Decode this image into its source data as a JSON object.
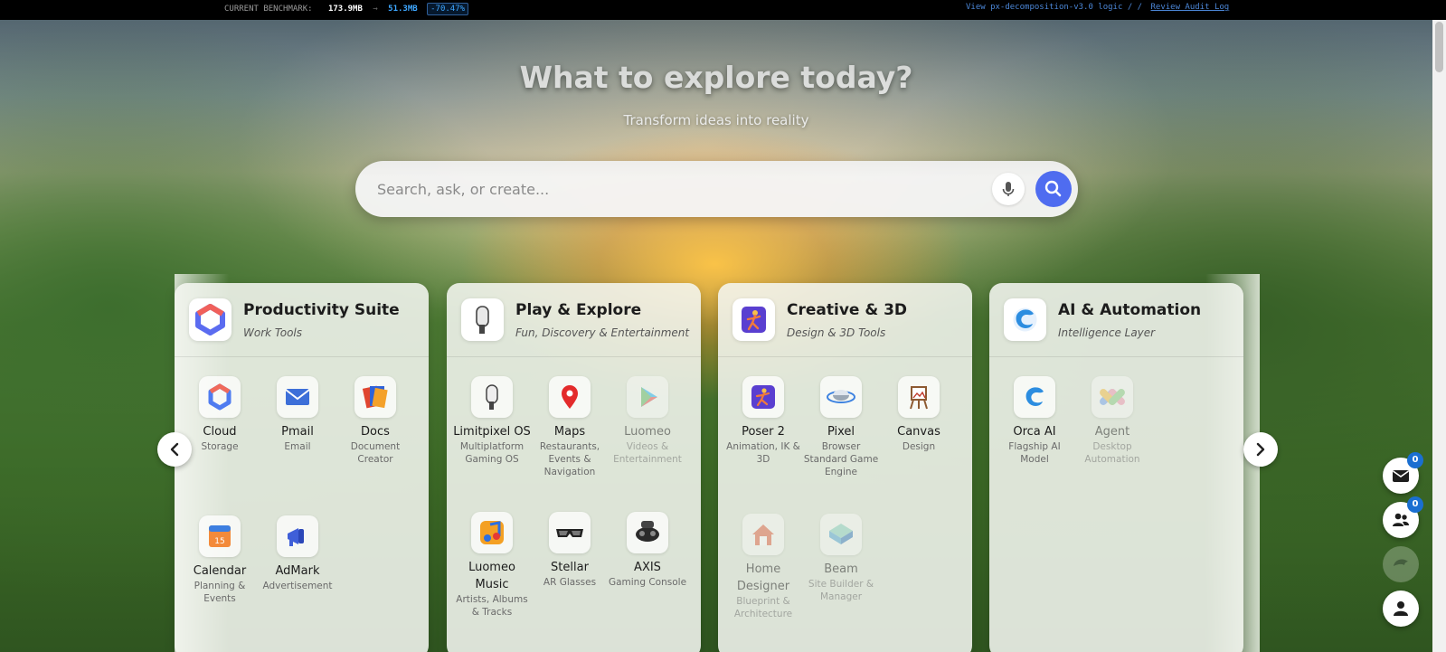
{
  "benchmark": {
    "label": "CURRENT BENCHMARK:",
    "value1": "173.9MB",
    "separator": "→",
    "value2": "51.3MB",
    "percent": "-70.47%"
  },
  "top_links": {
    "logic_link": "View px-decomposition-v3.0 logic",
    "separator": "/ /",
    "audit_link": "Review Audit Log"
  },
  "hero": {
    "title": "What to explore today?",
    "subtitle": "Transform ideas into reality"
  },
  "search": {
    "placeholder": "Search, ask, or create..."
  },
  "cards": [
    {
      "title": "Productivity Suite",
      "subtitle": "Work Tools",
      "icon": "suite-logo-icon",
      "apps": [
        {
          "name": "Cloud",
          "desc": "Storage",
          "icon": "cloud-storage-icon"
        },
        {
          "name": "Pmail",
          "desc": "Email",
          "icon": "mail-icon"
        },
        {
          "name": "Docs",
          "desc": "Document Creator",
          "icon": "docs-icon"
        },
        {
          "name": "Calendar",
          "desc": "Planning & Events",
          "icon": "calendar-icon"
        },
        {
          "name": "AdMark",
          "desc": "Advertisement",
          "icon": "megaphone-icon"
        }
      ]
    },
    {
      "title": "Play & Explore",
      "subtitle": "Fun, Discovery & Entertainment",
      "icon": "controller-icon",
      "apps": [
        {
          "name": "Limitpixel OS",
          "desc": "Multiplatform Gaming OS",
          "icon": "controller-icon"
        },
        {
          "name": "Maps",
          "desc": "Restaurants, Events & Navigation",
          "icon": "map-pin-icon"
        },
        {
          "name": "Luomeo",
          "desc": "Videos & Entertainment",
          "icon": "play-icon"
        },
        {
          "name": "Luomeo Music",
          "desc": "Artists, Albums & Tracks",
          "icon": "music-note-icon"
        },
        {
          "name": "Stellar",
          "desc": "AR Glasses",
          "icon": "ar-glasses-icon"
        },
        {
          "name": "AXIS",
          "desc": "Gaming Console",
          "icon": "gaming-console-icon"
        }
      ]
    },
    {
      "title": "Creative & 3D",
      "subtitle": "Design & 3D Tools",
      "icon": "poser-figure-icon",
      "apps": [
        {
          "name": "Poser 2",
          "desc": "Animation, IK & 3D",
          "icon": "poser-figure-icon"
        },
        {
          "name": "Pixel",
          "desc": "Browser Standard Game Engine",
          "icon": "orbit-engine-icon"
        },
        {
          "name": "Canvas",
          "desc": "Design",
          "icon": "easel-icon"
        },
        {
          "name": "Home Designer",
          "desc": "Blueprint & Architecture",
          "icon": "house-icon"
        },
        {
          "name": "Beam",
          "desc": "Site Builder & Manager",
          "icon": "layers-icon"
        }
      ]
    },
    {
      "title": "AI & Automation",
      "subtitle": "Intelligence Layer",
      "icon": "orca-icon",
      "apps": [
        {
          "name": "Orca AI",
          "desc": "Flagship AI Model",
          "icon": "orca-icon"
        },
        {
          "name": "Agent",
          "desc": "Desktop Automation",
          "icon": "agent-knot-icon"
        }
      ]
    }
  ],
  "floating": {
    "messages_count": "0",
    "contacts_count": "0"
  },
  "colors": {
    "accent": "#4f6cf0",
    "badge": "#1a6fd1",
    "benchmark_blue": "#3ea7ff"
  }
}
